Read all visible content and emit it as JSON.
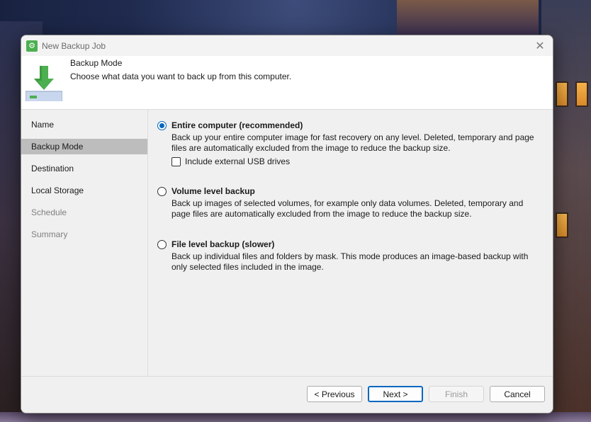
{
  "window": {
    "title": "New Backup Job",
    "close_glyph": "✕"
  },
  "header": {
    "title": "Backup Mode",
    "description": "Choose what data you want to back up from this computer."
  },
  "sidebar": {
    "items": [
      {
        "label": "Name",
        "state": "normal"
      },
      {
        "label": "Backup Mode",
        "state": "active"
      },
      {
        "label": "Destination",
        "state": "normal"
      },
      {
        "label": "Local Storage",
        "state": "normal"
      },
      {
        "label": "Schedule",
        "state": "disabled"
      },
      {
        "label": "Summary",
        "state": "disabled"
      }
    ]
  },
  "options": [
    {
      "title": "Entire computer (recommended)",
      "description": "Back up your entire computer image for fast recovery on any level. Deleted, temporary and page files are automatically excluded from the image to reduce the backup size.",
      "selected": true,
      "checkbox_label": "Include external USB drives",
      "checkbox_checked": false
    },
    {
      "title": "Volume level backup",
      "description": "Back up images of selected volumes, for example only data volumes. Deleted, temporary and page files are automatically excluded from the image to reduce the backup size.",
      "selected": false
    },
    {
      "title": "File level backup (slower)",
      "description": "Back up individual files and folders by mask. This mode produces an image-based backup with only selected files included in the image.",
      "selected": false
    }
  ],
  "footer": {
    "previous_label": "< Previous",
    "next_label": "Next >",
    "finish_label": "Finish",
    "cancel_label": "Cancel"
  },
  "colors": {
    "accent": "#0067c0",
    "app_icon": "#4caf50",
    "selected_nav": "#bdbdbd"
  },
  "icons": {
    "app": "gear-icon",
    "header": "download-arrow-icon",
    "close": "close-icon"
  }
}
